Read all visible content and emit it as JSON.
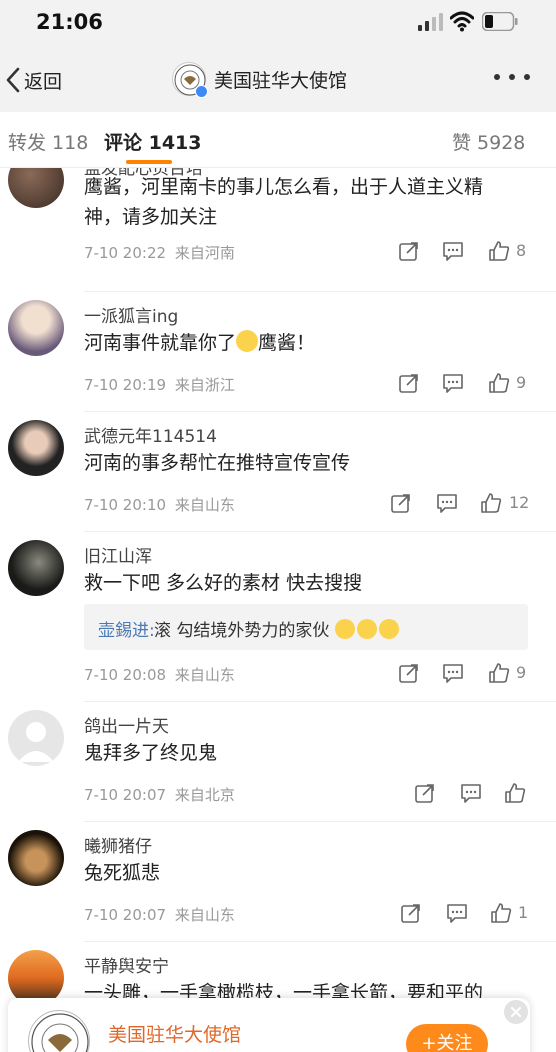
{
  "status_bar": {
    "time": "21:06"
  },
  "nav": {
    "back_label": "返回",
    "title": "美国驻华大使馆"
  },
  "tabs": [
    {
      "label": "转发 118"
    },
    {
      "label": "评论 1413"
    },
    {
      "label": "赞 5928"
    }
  ],
  "comments": [
    {
      "user": "盖发配心页台培",
      "text_lines": [
        "鹰酱，河里南卡的事儿怎么看，出于人道主义精",
        "神，请多加关注"
      ],
      "time": "7-10 20:22",
      "location": "来自河南",
      "likes": "8"
    },
    {
      "user": "一派狐言ing",
      "text_before_emoji": "河南事件就靠你了",
      "emoji": "thinking-face",
      "text_after_emoji": "鹰酱！",
      "time": "7-10 20:19",
      "location": "来自浙江",
      "likes": "9"
    },
    {
      "user": "武德元年114514",
      "text": "河南的事多帮忙在推特宣传宣传",
      "time": "7-10 20:10",
      "location": "来自山东",
      "likes": "12"
    },
    {
      "user": "旧江山浑",
      "text": "救一下吧  多么好的素材 快去搜搜",
      "reply": {
        "user": "壶錫进:",
        "text": "滚 勾结境外势力的家伙",
        "emojis": [
          "crying-face",
          "crying-face",
          "crying-face"
        ]
      },
      "time": "7-10 20:08",
      "location": "来自山东",
      "likes": "9"
    },
    {
      "user": "鸽出一片天",
      "text": "鬼拜多了终见鬼",
      "time": "7-10 20:07",
      "location": "来自北京",
      "likes": ""
    },
    {
      "user": "曦狮猪仔",
      "text": "兔死狐悲",
      "time": "7-10 20:07",
      "location": "来自山东",
      "likes": "1"
    },
    {
      "user": "平静舆安宁",
      "text": "一头雕，一手拿橄榄枝，一手拿长箭，要和平的",
      "time": "",
      "location": "",
      "likes": ""
    }
  ],
  "follow_card": {
    "name": "美国驻华大使馆",
    "button_label": "+关注"
  },
  "colors": {
    "accent": "#ff8200",
    "link": "#4a78b5",
    "verified": "#3d8af7"
  }
}
